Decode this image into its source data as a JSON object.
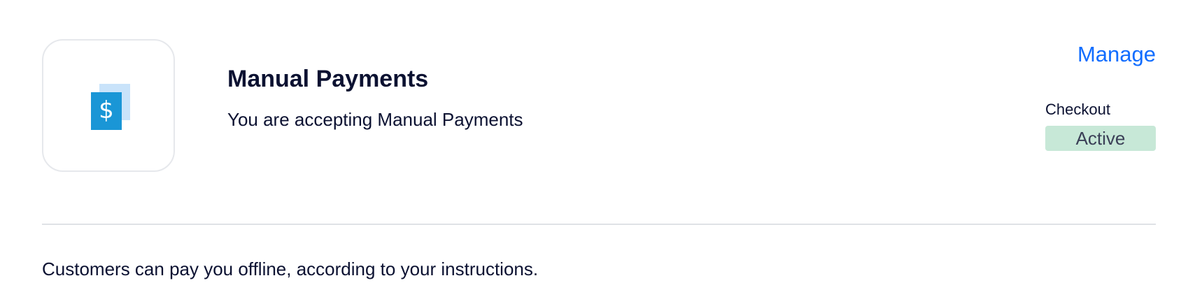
{
  "payment_method": {
    "icon": "dollar-document-icon",
    "title": "Manual Payments",
    "subtitle": "You are accepting Manual Payments",
    "manage_label": "Manage",
    "checkout_label": "Checkout",
    "status": "Active",
    "description": "Customers can pay you offline, according to your instructions."
  },
  "colors": {
    "accent": "#116dff",
    "status_badge_bg": "#c7e8d7",
    "icon_primary": "#1a96d6",
    "icon_secondary": "#c9e3fa",
    "text": "#0b1131"
  }
}
